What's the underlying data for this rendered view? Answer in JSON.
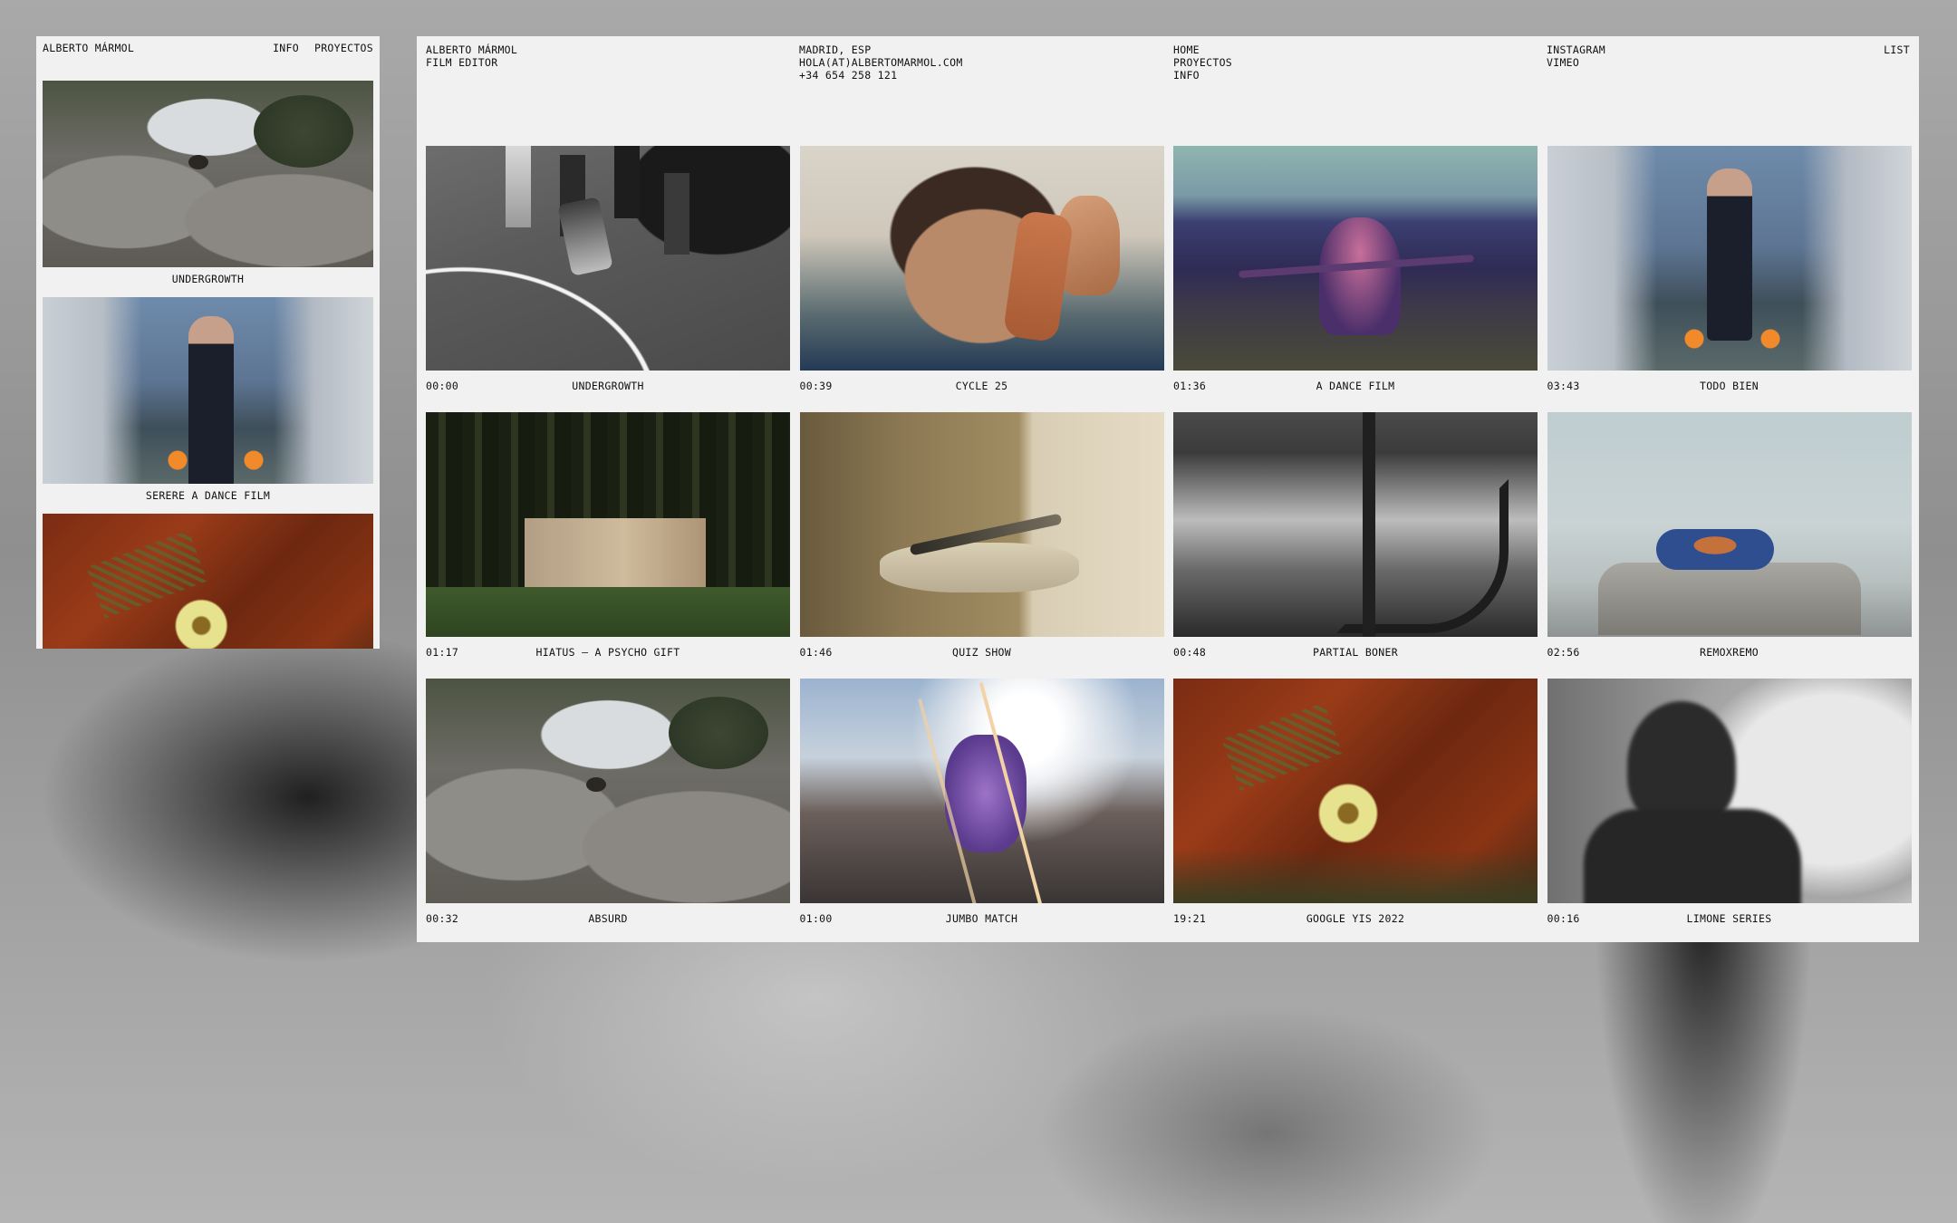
{
  "mobile": {
    "brand": "ALBERTO MÁRMOL",
    "nav": [
      "INFO",
      "PROYECTOS"
    ],
    "items": [
      {
        "caption": "UNDERGROWTH",
        "thumb": "t-rocks"
      },
      {
        "caption": "SERERE A DANCE FILM",
        "thumb": "t-boy"
      },
      {
        "caption": "",
        "thumb": "t-flower"
      }
    ]
  },
  "header": {
    "identity": [
      "ALBERTO MÁRMOL",
      "FILM EDITOR"
    ],
    "contact": [
      "MADRID, ESP",
      "HOLA(AT)ALBERTOMARMOL.COM",
      "+34 654 258 121"
    ],
    "nav": [
      "HOME",
      "PROYECTOS",
      "INFO"
    ],
    "social": [
      "INSTAGRAM",
      "VIMEO"
    ],
    "view_toggle": "LIST"
  },
  "projects": [
    {
      "time": "00:00",
      "title": "UNDERGROWTH",
      "thumb": "t-court"
    },
    {
      "time": "00:39",
      "title": "CYCLE 25",
      "thumb": "t-portrait"
    },
    {
      "time": "01:36",
      "title": "A DANCE FILM",
      "thumb": "t-dusk"
    },
    {
      "time": "03:43",
      "title": "TODO BIEN",
      "thumb": "t-boy"
    },
    {
      "time": "01:17",
      "title": "HIATUS – A PSYCHO GIFT",
      "thumb": "t-forest"
    },
    {
      "time": "01:46",
      "title": "QUIZ SHOW",
      "thumb": "t-dagger"
    },
    {
      "time": "00:48",
      "title": "PARTIAL BONER",
      "thumb": "t-stairs"
    },
    {
      "time": "02:56",
      "title": "REMOXREMO",
      "thumb": "t-sky"
    },
    {
      "time": "00:32",
      "title": "ABSURD",
      "thumb": "t-rocks"
    },
    {
      "time": "01:00",
      "title": "JUMBO MATCH",
      "thumb": "t-flare"
    },
    {
      "time": "19:21",
      "title": "GOOGLE YIS 2022",
      "thumb": "t-flower"
    },
    {
      "time": "00:16",
      "title": "LIMONE SERIES",
      "thumb": "t-silhouette"
    }
  ]
}
